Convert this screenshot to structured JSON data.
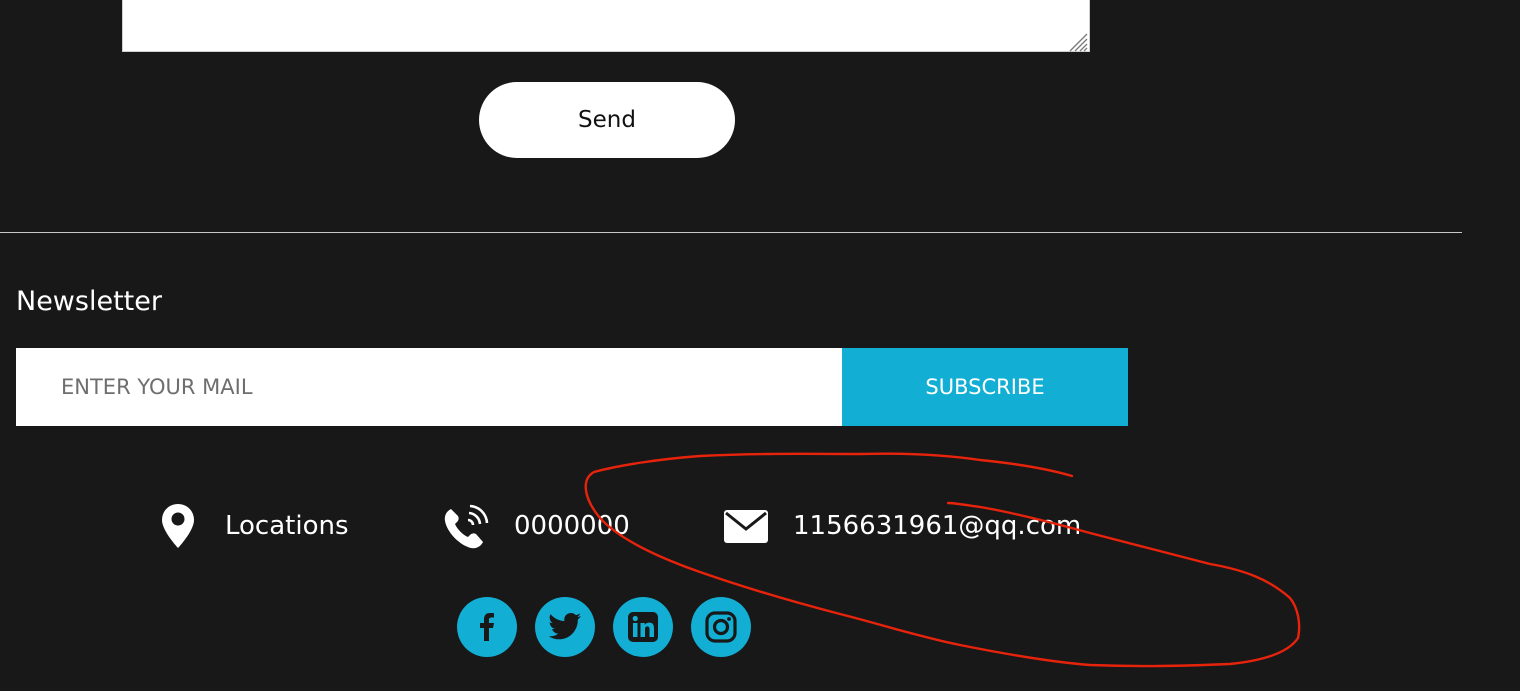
{
  "contact_form": {
    "message_value": "",
    "send_label": "Send"
  },
  "newsletter": {
    "title": "Newsletter",
    "email_placeholder": "ENTER YOUR MAIL",
    "subscribe_label": "SUBSCRIBE"
  },
  "contact_info": {
    "location_label": "Locations",
    "location_icon": "map-pin-icon",
    "phone": "0000000",
    "phone_icon": "phone-icon",
    "email": "1156631961@qq.com",
    "email_icon": "envelope-icon"
  },
  "social_links": [
    {
      "name": "facebook",
      "icon": "facebook-icon"
    },
    {
      "name": "twitter",
      "icon": "twitter-icon"
    },
    {
      "name": "linkedin",
      "icon": "linkedin-icon"
    },
    {
      "name": "instagram",
      "icon": "instagram-icon"
    }
  ],
  "colors": {
    "background": "#181818",
    "accent": "#12aed4",
    "annotation": "#e8230c",
    "text": "#ffffff"
  }
}
